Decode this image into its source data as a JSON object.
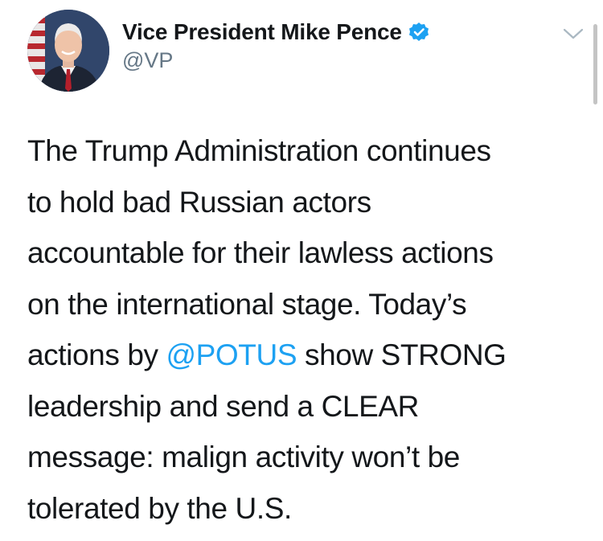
{
  "tweet": {
    "author": {
      "display_name": "Vice President Mike Pence",
      "handle": "@VP",
      "verified": true,
      "avatar_icon": "portrait-avatar"
    },
    "menu_icon": "chevron-down-icon",
    "text_lines": [
      {
        "pre": "The Trump Administration continues",
        "mention": "",
        "post": ""
      },
      {
        "pre": "to hold bad Russian actors",
        "mention": "",
        "post": ""
      },
      {
        "pre": "accountable for their lawless actions",
        "mention": "",
        "post": ""
      },
      {
        "pre": "on the international stage. Today’s",
        "mention": "",
        "post": ""
      },
      {
        "pre": "actions by ",
        "mention": "@POTUS",
        "post": " show STRONG"
      },
      {
        "pre": "leadership and send a CLEAR",
        "mention": "",
        "post": ""
      },
      {
        "pre": "message: malign activity won’t be",
        "mention": "",
        "post": ""
      },
      {
        "pre": "tolerated by the U.S.",
        "mention": "",
        "post": ""
      }
    ]
  },
  "colors": {
    "text": "#14171a",
    "secondary": "#657786",
    "link": "#1da1f2",
    "verified_badge": "#1da1f2"
  }
}
